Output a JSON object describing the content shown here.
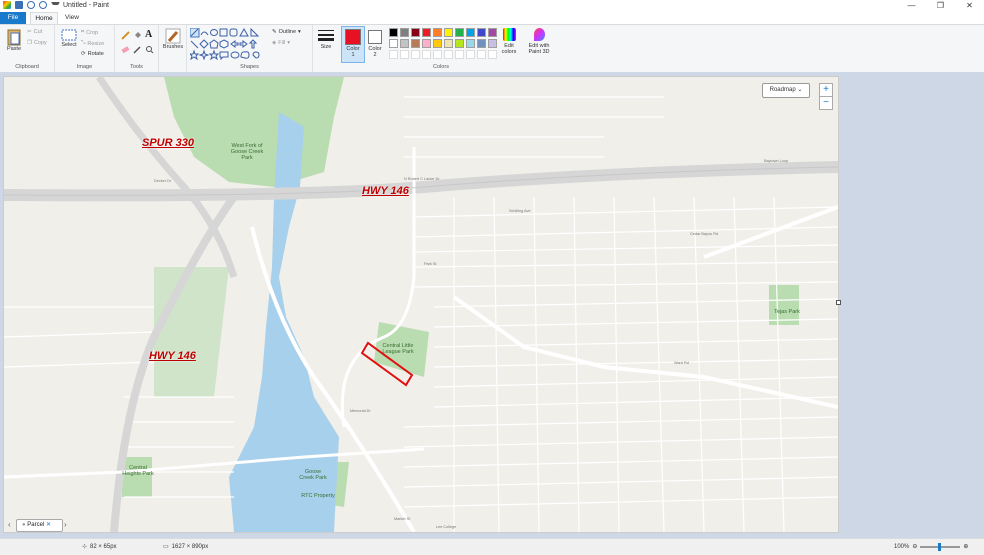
{
  "window": {
    "title": "Untitled - Paint",
    "controls": [
      "—",
      "❐",
      "✕"
    ]
  },
  "tabs": {
    "file": "File",
    "home": "Home",
    "view": "View"
  },
  "ribbon": {
    "clipboard": {
      "label": "Clipboard",
      "paste": "Paste",
      "cut": "Cut",
      "copy": "Copy"
    },
    "image": {
      "label": "Image",
      "select": "Select",
      "crop": "Crop",
      "resize": "Resize",
      "rotate": "Rotate"
    },
    "tools": {
      "label": "Tools"
    },
    "brushes": {
      "label": "Brushes"
    },
    "shapes": {
      "label": "Shapes",
      "outline": "Outline",
      "fill": "Fill"
    },
    "size": {
      "label": "Size"
    },
    "color1": {
      "label": "Color 1",
      "value": "#e81123"
    },
    "color2": {
      "label": "Color 2",
      "value": "#ffffff"
    },
    "colors": {
      "label": "Colors",
      "row1": [
        "#000000",
        "#7f7f7f",
        "#880015",
        "#ed1c24",
        "#ff7f27",
        "#fff200",
        "#22b14c",
        "#00a2e8",
        "#3f48cc",
        "#a349a4"
      ],
      "row2": [
        "#ffffff",
        "#c3c3c3",
        "#b97a57",
        "#ffaec9",
        "#ffc90e",
        "#efe4b0",
        "#b5e61d",
        "#99d9ea",
        "#7092be",
        "#c8bfe7"
      ]
    },
    "edit_colors": "Edit colors",
    "paint3d": "Edit with Paint 3D"
  },
  "map": {
    "roadmap": "Roadmap",
    "labels": {
      "spur330": "SPUR 330",
      "hwy146a": "HWY 146",
      "hwy146b": "HWY 146",
      "westfork": "West Fork of Goose Creek Park",
      "central_little_league": "Central Little League Park",
      "tejas": "Tejas Park",
      "goose_creek": "Goose Creek Park",
      "central_heights": "Central Heights Park",
      "rtc": "RTC Property",
      "baytown_loop": "Baytown Loop",
      "park_st": "Park St",
      "market_st": "Market St",
      "lee_college": "Lee College",
      "memorial_dr": "Memorial Dr",
      "ward_rd": "Ward Rd",
      "schilling": "Schilling Ave",
      "cedar_bayou": "Cedar Bayou Rd",
      "decker_dr": "Decker Dr",
      "robert_lanier": "N Robert C Lanier Dr"
    },
    "parcel_tab": "Parcel"
  },
  "status": {
    "cursor": "82 × 65px",
    "size": "1627 × 890px",
    "zoom": "100%"
  }
}
